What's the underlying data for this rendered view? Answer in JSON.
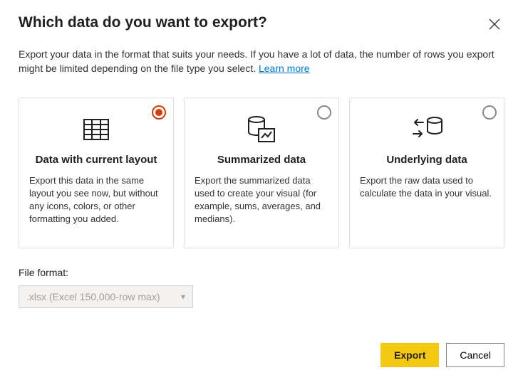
{
  "dialog": {
    "title": "Which data do you want to export?",
    "description": "Export your data in the format that suits your needs. If you have a lot of data, the number of rows you export might be limited depending on the file type you select.  ",
    "learn_more": "Learn more"
  },
  "options": [
    {
      "title": "Data with current layout",
      "description": "Export this data in the same layout you see now, but without any icons, colors, or other formatting you added.",
      "selected": true
    },
    {
      "title": "Summarized data",
      "description": "Export the summarized data used to create your visual (for example, sums, averages, and medians).",
      "selected": false
    },
    {
      "title": "Underlying data",
      "description": "Export the raw data used to calculate the data in your visual.",
      "selected": false
    }
  ],
  "file_format": {
    "label": "File format:",
    "selected": ".xlsx (Excel 150,000-row max)"
  },
  "buttons": {
    "export": "Export",
    "cancel": "Cancel"
  }
}
